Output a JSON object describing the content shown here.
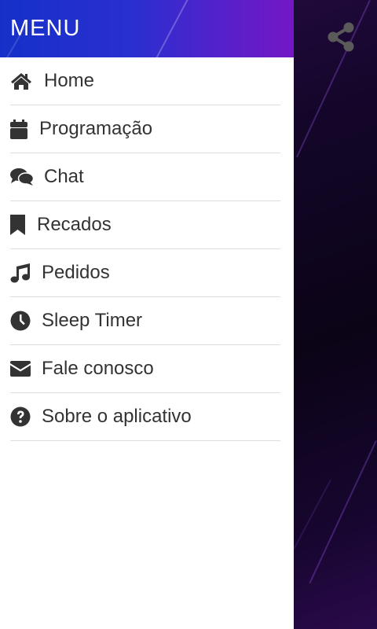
{
  "drawer": {
    "title": "MENU",
    "items": [
      {
        "label": "Home",
        "icon": "home-icon"
      },
      {
        "label": "Programação",
        "icon": "calendar-icon"
      },
      {
        "label": "Chat",
        "icon": "chat-icon"
      },
      {
        "label": "Recados",
        "icon": "bookmark-icon"
      },
      {
        "label": "Pedidos",
        "icon": "music-note-icon"
      },
      {
        "label": "Sleep Timer",
        "icon": "clock-icon"
      },
      {
        "label": "Fale conosco",
        "icon": "envelope-icon"
      },
      {
        "label": "Sobre o aplicativo",
        "icon": "question-circle-icon"
      }
    ]
  },
  "topbar": {
    "share_icon": "share-icon"
  },
  "colors": {
    "header_start": "#1530c8",
    "header_end": "#7417c6",
    "icon_color": "#333333",
    "share_icon_color": "#5a5a5a"
  }
}
